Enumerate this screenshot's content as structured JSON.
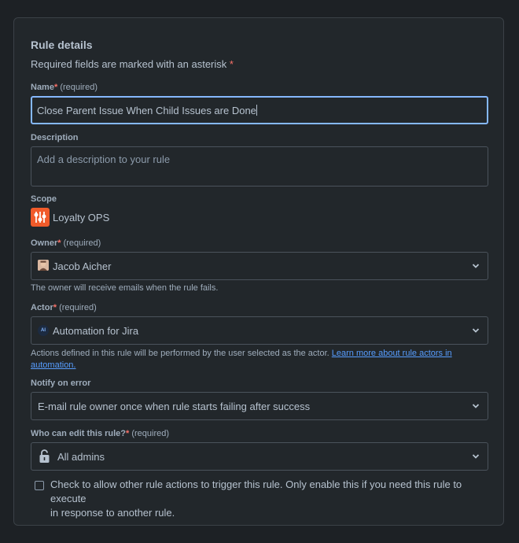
{
  "section": {
    "title": "Rule details",
    "required_note": "Required fields are marked with an asterisk",
    "asterisk": "*"
  },
  "name": {
    "label": "Name",
    "required": "(required)",
    "value": "Close Parent Issue When Child Issues are Done"
  },
  "description": {
    "label": "Description",
    "placeholder": "Add a description to your rule"
  },
  "scope": {
    "label": "Scope",
    "value": "Loyalty OPS"
  },
  "owner": {
    "label": "Owner",
    "required": "(required)",
    "value": "Jacob Aicher",
    "helper": "The owner will receive emails when the rule fails."
  },
  "actor": {
    "label": "Actor",
    "required": "(required)",
    "value": "Automation for Jira",
    "icon_text": "AI",
    "helper": "Actions defined in this rule will be performed by the user selected as the actor.",
    "link_line1": "Learn more about rule actors in",
    "link_line2": "automation."
  },
  "notify": {
    "label": "Notify on error",
    "value": "E-mail rule owner once when rule starts failing after success"
  },
  "editors": {
    "label": "Who can edit this rule?",
    "required": "(required)",
    "value": "All admins"
  },
  "trigger_check": {
    "line1": "Check to allow other rule actions to trigger this rule. Only enable this if you need this rule to execute",
    "line2": "in response to another rule."
  },
  "icons": {
    "scope": "project-icon",
    "owner": "avatar",
    "actor": "automation-icon",
    "editors": "lock-icon",
    "dropdown": "chevron-down-icon"
  },
  "colors": {
    "background": "#1d2125",
    "panel": "#22272b",
    "focus_border": "#85b8ff",
    "required_asterisk": "#f87168",
    "link": "#579dff",
    "scope_icon": "#f15b2a"
  }
}
